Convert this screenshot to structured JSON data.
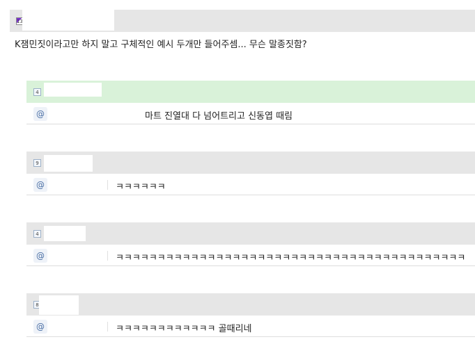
{
  "post": {
    "level": "13",
    "body": "K잼민짓이라고만 하지 말고 구체적인 예시 두개만 들어주셈... 무슨 말종짓함?"
  },
  "comments": [
    {
      "level": "4",
      "icon": "@",
      "text": "마트 진열대 다 넘어트리고 신동엽 때림"
    },
    {
      "level": "9",
      "icon": "@",
      "text": "ㅋㅋㅋㅋㅋㅋ"
    },
    {
      "level": "4",
      "icon": "@",
      "text": "ㅋㅋㅋㅋㅋㅋㅋㅋㅋㅋㅋㅋㅋㅋㅋㅋㅋㅋㅋㅋㅋㅋㅋㅋㅋㅋㅋㅋㅋㅋㅋㅋㅋㅋㅋㅋㅋㅋㅋㅋㅋㅋ"
    },
    {
      "level": "8",
      "icon": "@",
      "text": "ㅋㅋㅋㅋㅋㅋㅋㅋㅋㅋㅋㅋ 골때리네"
    }
  ]
}
